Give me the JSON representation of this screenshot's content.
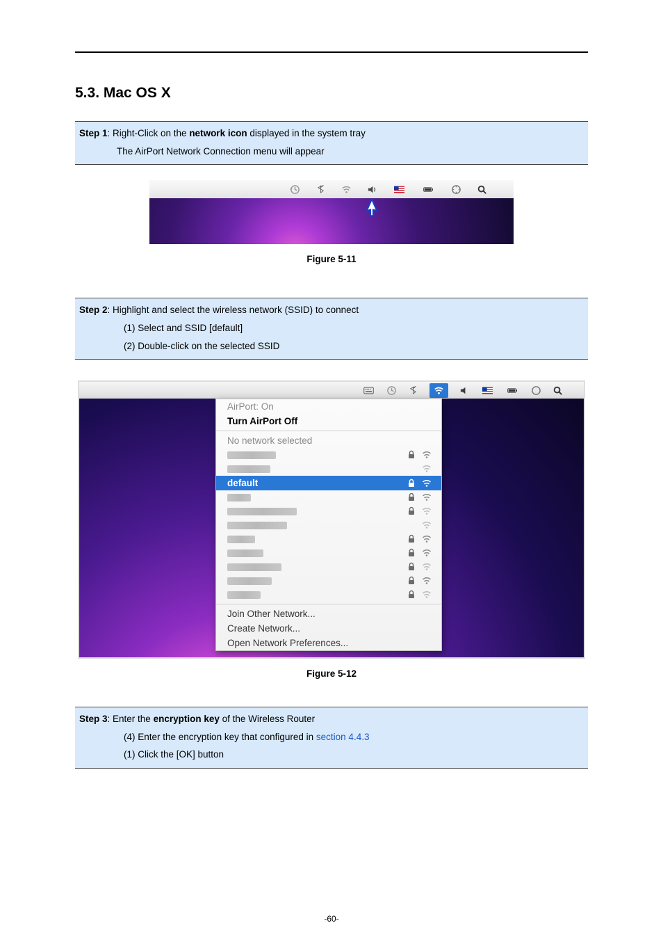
{
  "heading": "5.3.  Mac OS X",
  "step1": {
    "prefix": "Step 1",
    "text_before": ": Right-Click on the ",
    "bold1": "network icon",
    "text_after": " displayed in the system tray",
    "line2": "The AirPort Network Connection menu will appear"
  },
  "fig11_caption": "Figure 5-11",
  "step2": {
    "prefix": "Step 2",
    "text1": ": Highlight and select the wireless network (SSID) to connect",
    "item1": "(1)  Select and SSID [",
    "item1_bold": "default",
    "item1_after": "]",
    "item2": "(2)  Double-click on the selected SSID"
  },
  "fig12_caption": "Figure 5-12",
  "fig12_menu": {
    "airport_status": "AirPort: On",
    "turn_off": "Turn AirPort Off",
    "no_network": "No network selected",
    "default": "default",
    "join_other": "Join Other Network...",
    "create": "Create Network...",
    "open_prefs": "Open Network Preferences..."
  },
  "step3": {
    "prefix": "Step 3",
    "text_before": ": Enter the ",
    "bold1": "encryption key",
    "text_after": " of the Wireless Router",
    "item1a": "(4)  Enter the encryption key that configured in ",
    "item1_link": "section 4.4.3",
    "item2": "(1)  Click the [OK] button"
  },
  "page_number": "-60-",
  "icons": {
    "timemachine": "timemachine-icon",
    "bluetooth": "bluetooth-icon",
    "wifi": "wifi-icon",
    "volume": "volume-icon",
    "flag": "flag-us-icon",
    "battery": "battery-icon",
    "sync": "sync-icon",
    "spotlight": "spotlight-icon",
    "input": "input-source-icon",
    "lock": "lock-icon"
  }
}
